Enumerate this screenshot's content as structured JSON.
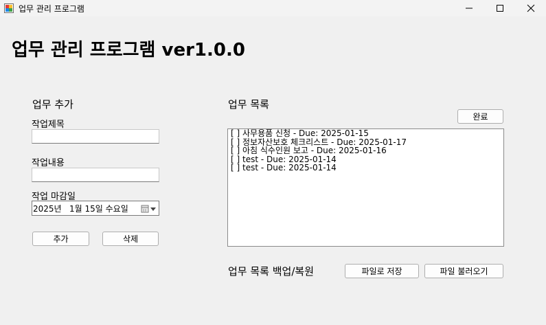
{
  "window": {
    "title": "업무 관리 프로그램",
    "minimize_icon": "minimize-icon",
    "maximize_icon": "maximize-icon",
    "close_icon": "close-icon"
  },
  "header": {
    "title": "업무 관리 프로그램 ver1.0.0"
  },
  "add_section": {
    "title": "업무 추가",
    "task_title_label": "작업제목",
    "task_title_value": "",
    "task_content_label": "작업내용",
    "task_content_value": "",
    "due_label": "작업 마감일",
    "due_value": "2025년   1월 15일 수요일",
    "add_button": "추가",
    "delete_button": "삭제"
  },
  "list_section": {
    "title": "업무 목록",
    "complete_button": "완료",
    "items": [
      "[ ] 사무용품 신청 - Due: 2025-01-15",
      "[ ] 정보자산보호 체크리스트 - Due: 2025-01-17",
      "[ ] 아침 식수인원 보고 - Due: 2025-01-16",
      "[ ] test - Due: 2025-01-14",
      "[ ] test - Due: 2025-01-14"
    ]
  },
  "backup_section": {
    "title": "업무 목록 백업/복원",
    "save_button": "파일로 저장",
    "load_button": "파일 불러오기"
  }
}
